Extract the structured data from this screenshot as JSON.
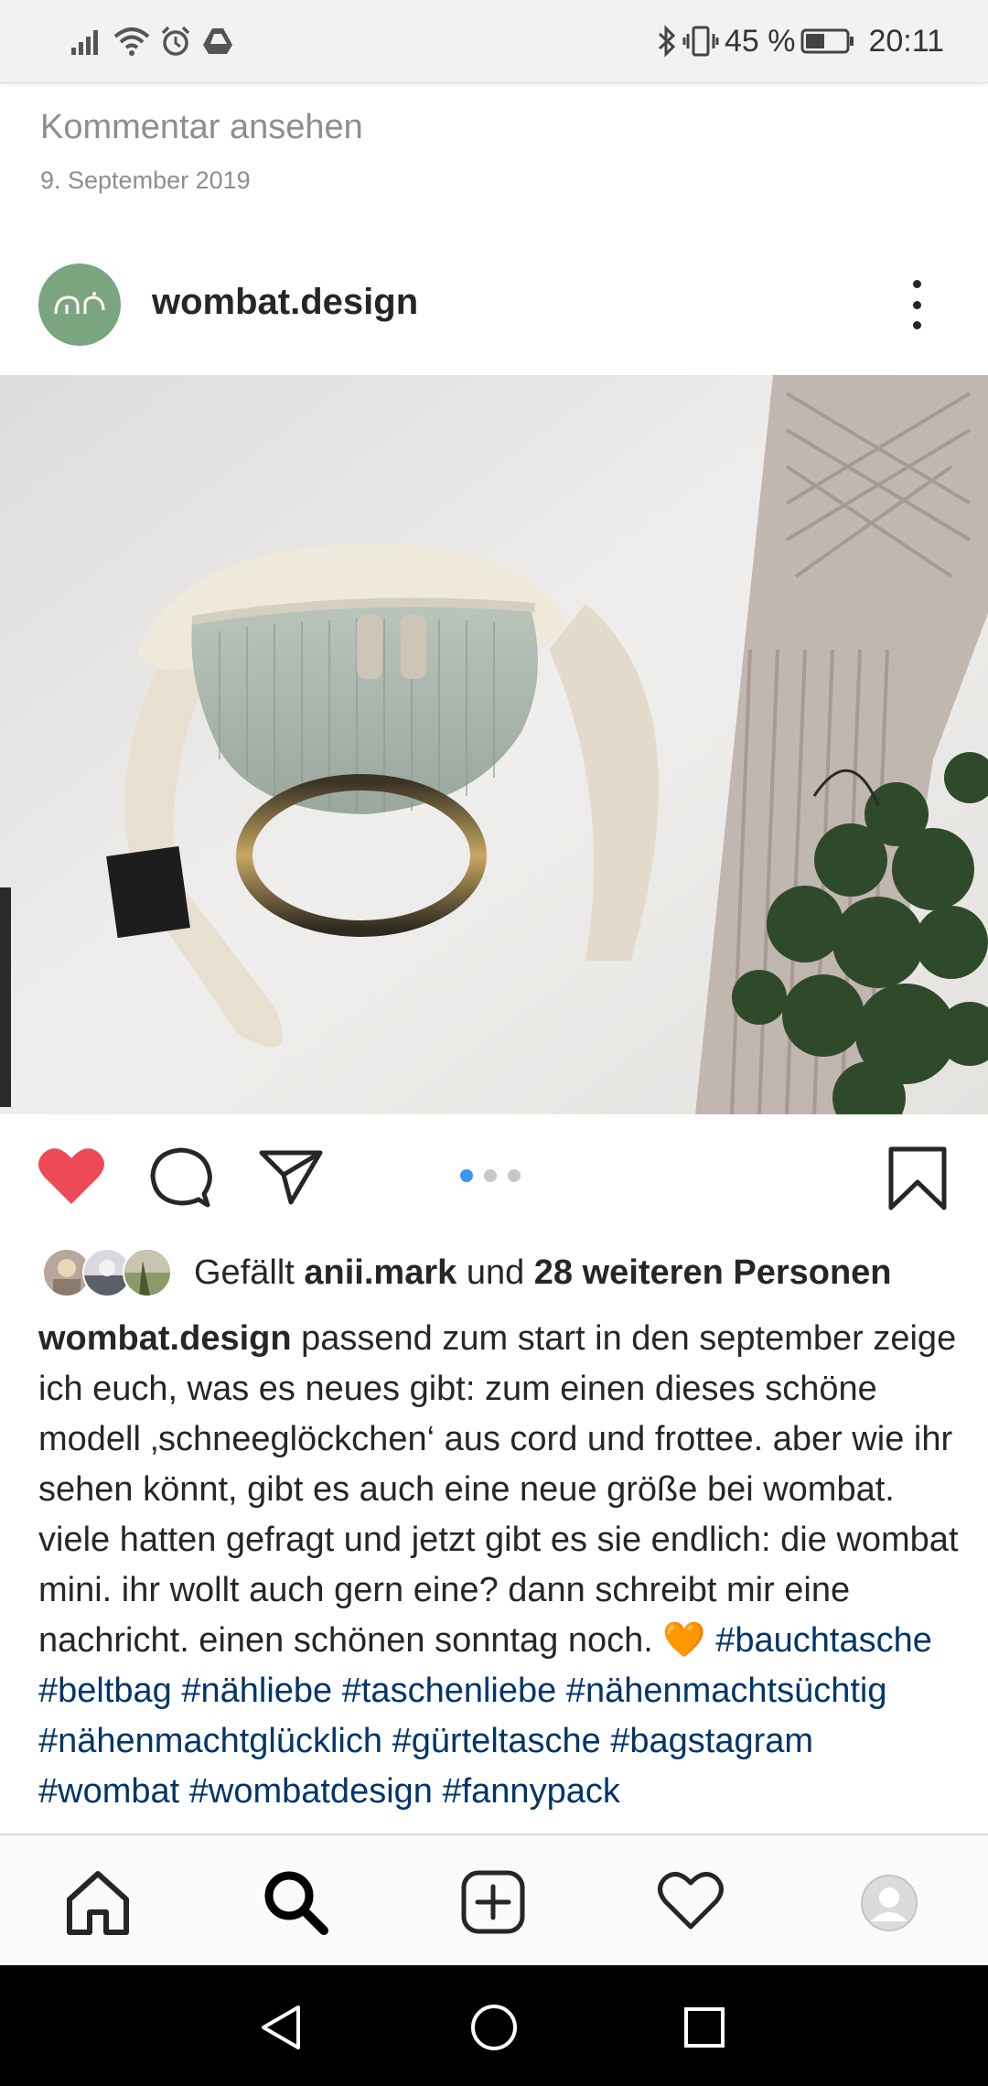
{
  "status_bar": {
    "battery": "45 %",
    "time": "20:11",
    "icons_left": [
      "signal-icon",
      "wifi-icon",
      "alarm-icon",
      "drive-icon"
    ],
    "icons_right": [
      "bluetooth-icon",
      "vibrate-icon",
      "battery-icon"
    ]
  },
  "previous_post": {
    "view_comments": "Kommentar ansehen",
    "date": "9. September 2019"
  },
  "post": {
    "username": "wombat.design",
    "carousel": {
      "count": 3,
      "active_index": 0
    },
    "likes": {
      "prefix": "Gefällt ",
      "user": "anii.mark",
      "middle": " und ",
      "others": "28 weiteren Personen"
    },
    "caption": {
      "username": "wombat.design",
      "text": " passend zum start in den september zeige ich euch, was es neues gibt: zum einen dieses schöne modell ‚schneeglöckchen‘ aus cord und frottee. aber wie ihr sehen könnt, gibt es auch eine neue größe bei wombat. viele hatten gefragt und jetzt gibt es sie endlich: die wombat mini. ihr wollt auch gern eine? dann schreibt mir eine nachricht. einen schönen sonntag noch. 🧡 ",
      "hashtags": "#bauchtasche #beltbag #nähliebe #taschenliebe #nähenmachtsüchtig #nähenmachtglücklich #gürteltasche #bagstagram #wombat #wombatdesign #fannypack"
    }
  },
  "colors": {
    "like_red": "#ed4956",
    "hashtag_blue": "#003569",
    "carousel_active": "#3897f0",
    "avatar_green": "#7aa57f"
  },
  "bottom_nav": [
    "home-icon",
    "search-icon",
    "new-post-icon",
    "activity-icon",
    "profile-icon"
  ]
}
